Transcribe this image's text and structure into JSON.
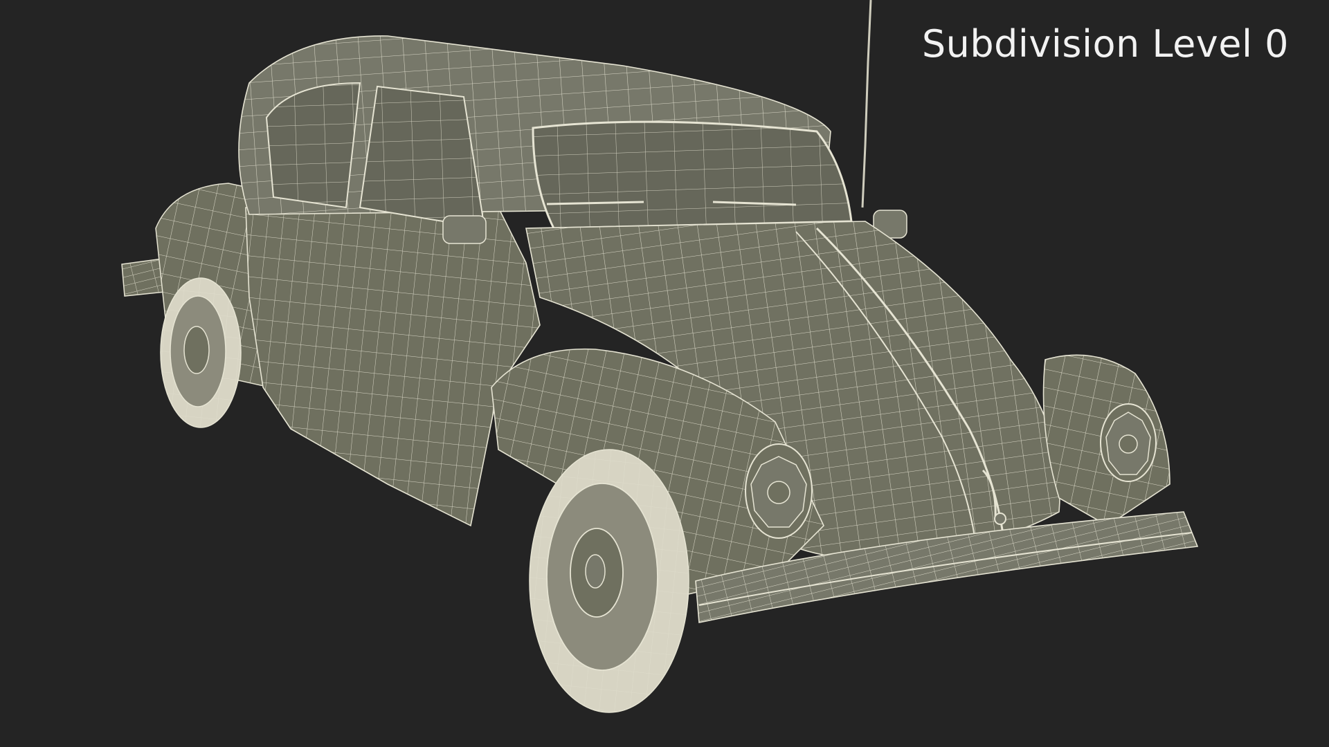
{
  "label": {
    "text": "Subdivision Level 0"
  },
  "colors": {
    "background": "#242424",
    "body": "#6f705f",
    "body_shadow": "#575849",
    "body_light": "#88897a",
    "wire": "#e6e4d3",
    "glass": "#66675a",
    "tire": "#d7d4c3",
    "label": "#f2f2f2"
  }
}
